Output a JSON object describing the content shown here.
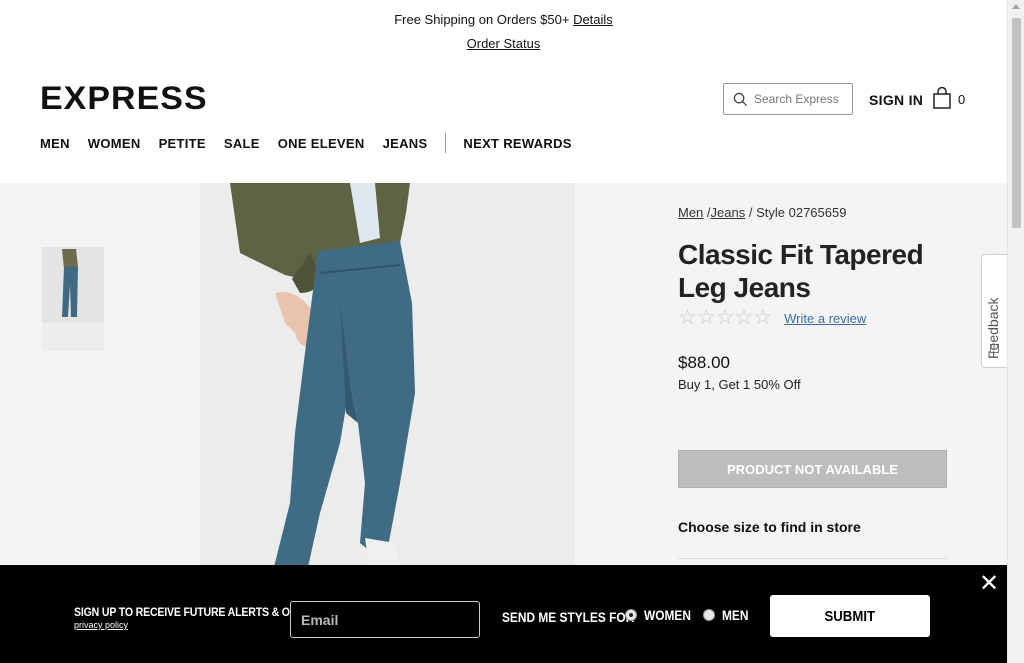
{
  "promo": {
    "shipping_text": "Free Shipping on Orders $50+",
    "details_link": "Details",
    "order_status_link": "Order Status"
  },
  "header": {
    "logo": "EXPRESS",
    "search_placeholder": "Search Express",
    "sign_in": "SIGN IN",
    "bag_count": "0",
    "nav": [
      "MEN",
      "WOMEN",
      "PETITE",
      "SALE",
      "ONE ELEVEN",
      "JEANS"
    ],
    "nav_rewards": "NEXT REWARDS"
  },
  "product": {
    "breadcrumb": [
      "Men",
      "Jeans"
    ],
    "breadcrumb_sep": "/",
    "style": "/ Style 02765659",
    "title": "Classic Fit Tapered Leg Jeans",
    "rating_stars": 0,
    "rating_max": 5,
    "write_review": "Write a review",
    "price": "$88.00",
    "offer": "Buy 1, Get 1 50% Off",
    "availability_button": "PRODUCT NOT AVAILABLE",
    "find_in_store": "Choose size to find in store"
  },
  "feedback": {
    "label": "Feedback"
  },
  "signup": {
    "headline": "SIGN UP TO RECEIVE FUTURE ALERTS & OFFERS",
    "privacy": "privacy policy",
    "email_placeholder": "Email",
    "styles_for": "SEND ME STYLES FOR",
    "options": [
      "WOMEN",
      "MEN"
    ],
    "selected": "WOMEN",
    "submit": "SUBMIT",
    "close": "✕"
  },
  "colors": {
    "accent_link": "#3a6ea8",
    "disabled_button": "#bdbdbd",
    "content_bg": "#f4f4f4",
    "overlay_bg": "#000000"
  }
}
